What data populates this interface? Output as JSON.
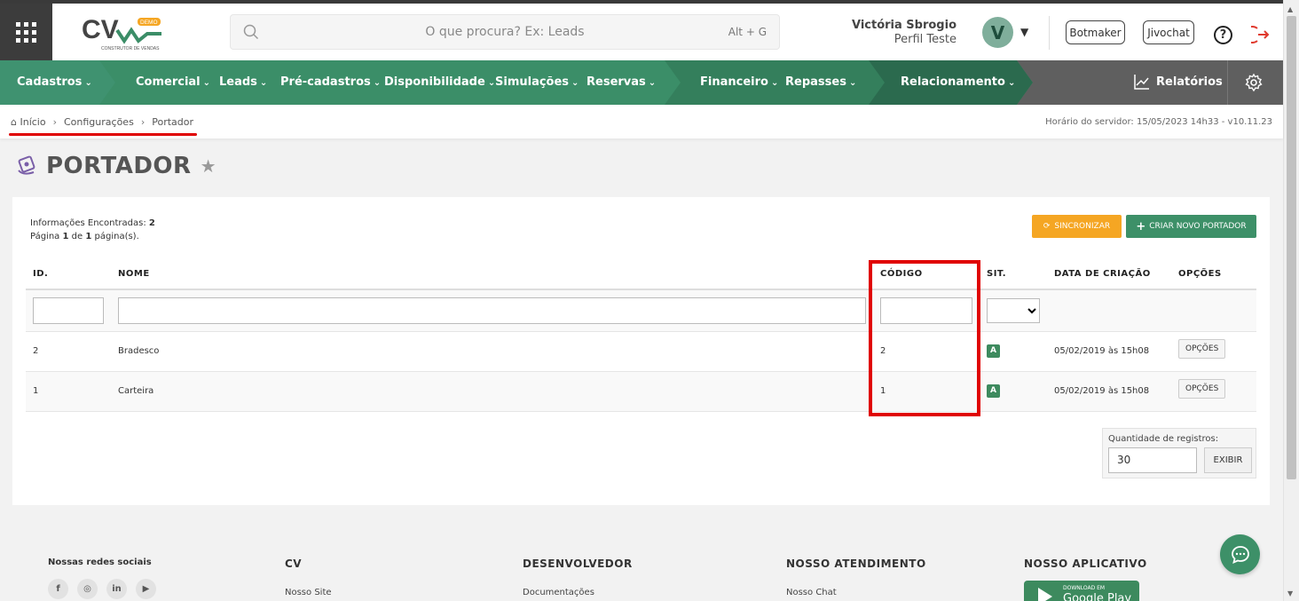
{
  "header": {
    "search_placeholder": "O que procura? Ex: Leads",
    "search_shortcut": "Alt + G",
    "user_name": "Victória Sbrogio",
    "user_profile": "Perfil Teste",
    "avatar_letter": "V",
    "logo_badge": "DEMO",
    "logo_text": "CV",
    "logo_subtitle": "CONSTRUTOR DE VENDAS",
    "botmaker_label": "Botmaker",
    "jivochat_label": "Jivochat",
    "help_label": "?"
  },
  "nav": {
    "items": [
      {
        "label": "Cadastros"
      },
      {
        "label": "Comercial"
      },
      {
        "label": "Leads"
      },
      {
        "label": "Pré-cadastros"
      },
      {
        "label": "Disponibilidade"
      },
      {
        "label": "Simulações"
      },
      {
        "label": "Reservas"
      },
      {
        "label": "Financeiro"
      },
      {
        "label": "Repasses"
      },
      {
        "label": "Relacionamento"
      }
    ],
    "reports_label": "Relatórios"
  },
  "breadcrumb": {
    "items": [
      "Início",
      "Configurações",
      "Portador"
    ],
    "server_time": "Horário do servidor: 15/05/2023 14h33 - v10.11.23"
  },
  "page": {
    "title": "PORTADOR",
    "info_label": "Informações Encontradas:",
    "info_count": "2",
    "page_prefix": "Página",
    "page_current": "1",
    "page_of": "de",
    "page_total": "1",
    "page_suffix": "página(s).",
    "sync_label": "SINCRONIZAR",
    "new_label": "CRIAR NOVO PORTADOR"
  },
  "table": {
    "columns": [
      "ID.",
      "NOME",
      "CÓDIGO",
      "SIT.",
      "DATA DE CRIAÇÃO",
      "OPÇÕES"
    ],
    "rows": [
      {
        "id": "2",
        "nome": "Bradesco",
        "codigo": "2",
        "sit": "A",
        "data": "05/02/2019 às 15h08",
        "opcoes": "OPÇÕES"
      },
      {
        "id": "1",
        "nome": "Carteira",
        "codigo": "1",
        "sit": "A",
        "data": "05/02/2019 às 15h08",
        "opcoes": "OPÇÕES"
      }
    ]
  },
  "records": {
    "label": "Quantidade de registros:",
    "value": "30",
    "button": "EXIBIR"
  },
  "footer": {
    "social_title": "Nossas redes sociais",
    "social_icons": [
      "f",
      "◎",
      "in",
      "▶"
    ],
    "cv_title": "CV",
    "cv_link": "Nosso Site",
    "dev_title": "DESENVOLVEDOR",
    "dev_link": "Documentações",
    "support_title": "NOSSO ATENDIMENTO",
    "support_link": "Nosso Chat",
    "app_title": "NOSSO APLICATIVO",
    "gplay_small": "DOWNLOAD EM",
    "gplay_big": "Google Play"
  },
  "colors": {
    "nav_green": "#3b8d67",
    "dark_green": "#2b6a4e",
    "orange": "#f5a623",
    "highlight_red": "#e00000"
  }
}
